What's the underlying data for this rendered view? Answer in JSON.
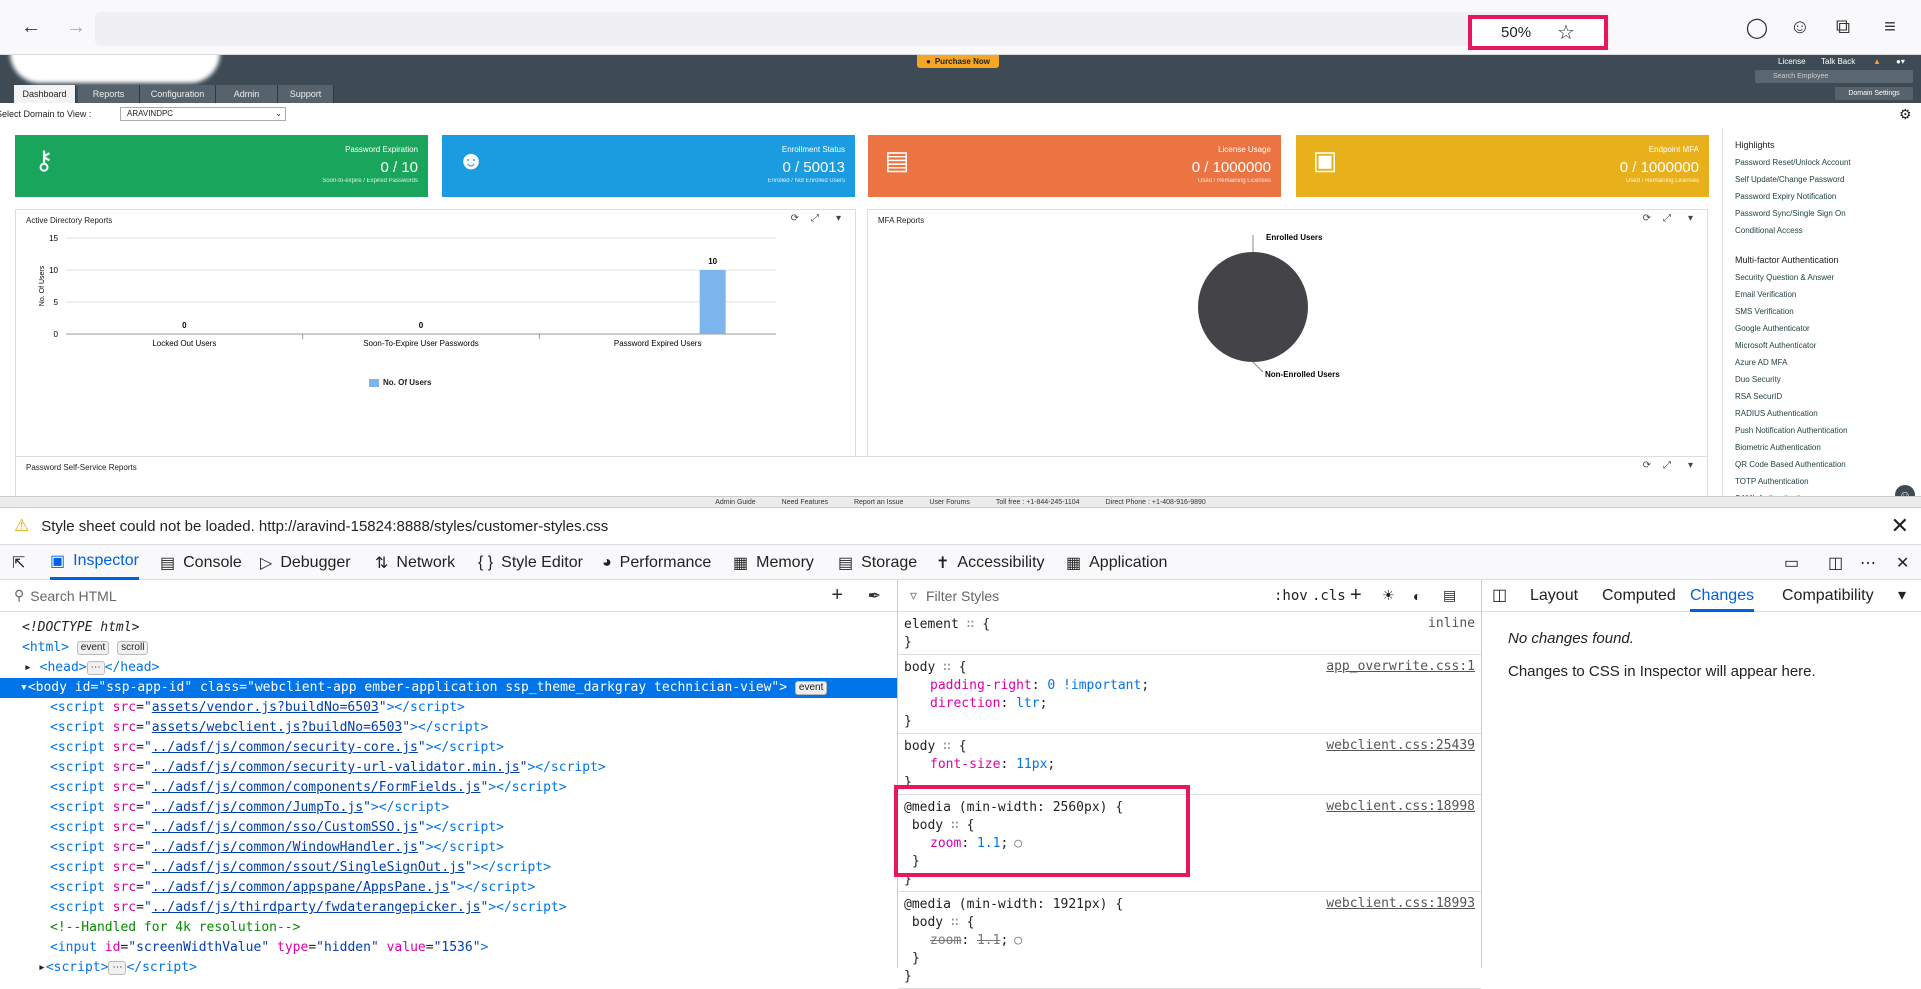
{
  "browser": {
    "zoom": "50%"
  },
  "app": {
    "purchase": "Purchase Now",
    "header_links": [
      "License",
      "Talk Back"
    ],
    "search_placeholder": "Search Employee",
    "domain_settings": "Domain Settings",
    "tabs": [
      "Dashboard",
      "Reports",
      "Configuration",
      "Admin",
      "Support"
    ],
    "domain_label": "Select Domain to View :",
    "domain_value": "ARAVINDPC",
    "cards": [
      {
        "title": "Password Expiration",
        "value": "0 / 10",
        "sub": "Soon-to-expire / Expired Passwords",
        "color": "#1aa55c"
      },
      {
        "title": "Enrollment Status",
        "value": "0 / 50013",
        "sub": "Enrolled / Not Enrolled Users",
        "color": "#1b9be0"
      },
      {
        "title": "License Usage",
        "value": "0 / 1000000",
        "sub": "Used / Remaining Licenses",
        "color": "#ec7442"
      },
      {
        "title": "Endpoint MFA",
        "value": "0 / 1000000",
        "sub": "Used / Remaining Licenses",
        "color": "#e8b01a"
      }
    ],
    "ad_panel_title": "Active Directory Reports",
    "mfa_panel_title": "MFA Reports",
    "pss_panel_title": "Password Self-Service Reports",
    "pie_labels": [
      "Enrolled Users",
      "Non-Enrolled Users"
    ],
    "highlights_title": "Highlights",
    "highlights": [
      "Password Reset/Unlock Account",
      "Self Update/Change Password",
      "Password Expiry Notification",
      "Password Sync/Single Sign On",
      "Conditional Access"
    ],
    "mfa_title": "Multi-factor Authentication",
    "mfa_items": [
      "Security Question & Answer",
      "Email Verification",
      "SMS Verification",
      "Google Authenticator",
      "Microsoft Authenticator",
      "Azure AD MFA",
      "Duo Security",
      "RSA SecurID",
      "RADIUS Authentication",
      "Push Notification Authentication",
      "Biometric Authentication",
      "QR Code Based Authentication",
      "TOTP Authentication",
      "SAML Authentication"
    ],
    "footer": [
      "Admin Guide",
      "Need Features",
      "Report an Issue",
      "User Forums",
      "Toll free : +1-844-245-1104",
      "Direct Phone : +1-408-916-9890"
    ]
  },
  "chart_data": {
    "type": "bar",
    "categories": [
      "Locked Out Users",
      "Soon-To-Expire User Passwords",
      "Password Expired Users"
    ],
    "values": [
      0,
      0,
      10
    ],
    "ylabel": "No. Of Users",
    "ylim": [
      0,
      15
    ],
    "yticks": [
      "15",
      "10",
      "5",
      "0"
    ],
    "legend": "No. Of Users",
    "color": "#7cb5ec"
  },
  "notification": {
    "text": "Style sheet could not be loaded. http://aravind-15824:8888/styles/customer-styles.css"
  },
  "devtools": {
    "tabs": [
      "Inspector",
      "Console",
      "Debugger",
      "Network",
      "Style Editor",
      "Performance",
      "Memory",
      "Storage",
      "Accessibility",
      "Application"
    ],
    "search_html_placeholder": "Search HTML",
    "filter_styles_placeholder": "Filter Styles",
    "hov": ":hov",
    "cls": ".cls",
    "side_tabs": [
      "Layout",
      "Computed",
      "Changes",
      "Compatibility"
    ],
    "no_changes": "No changes found.",
    "changes_hint": "Changes to CSS in Inspector will appear here.",
    "markup": {
      "doctype": "<!DOCTYPE html>",
      "html_open": "html",
      "html_badges": [
        "event",
        "scroll"
      ],
      "head": "<head>",
      "head_close": "</head>",
      "body_id": "ssp-app-id",
      "body_class": "webclient-app ember-application ssp_theme_darkgray technician-view",
      "body_badge": "event",
      "scripts": [
        "assets/vendor.js?buildNo=6503",
        "assets/webclient.js?buildNo=6503",
        "../adsf/js/common/security-core.js",
        "../adsf/js/common/security-url-validator.min.js",
        "../adsf/js/common/components/FormFields.js",
        "../adsf/js/common/JumpTo.js",
        "../adsf/js/common/sso/CustomSSO.js",
        "../adsf/js/common/WindowHandler.js",
        "../adsf/js/common/ssout/SingleSignOut.js",
        "../adsf/js/common/appspane/AppsPane.js",
        "../adsf/js/thirdparty/fwdaterangepicker.js"
      ],
      "comment": "<!--Handled for 4k resolution-->",
      "input_id": "screenWidthValue",
      "input_type": "hidden",
      "input_value": "1536"
    },
    "rules": [
      {
        "selector": "element",
        "source": "inline",
        "decls": []
      },
      {
        "selector": "body",
        "source": "app_overwrite.css:1",
        "decls": [
          {
            "p": "padding-right",
            "v": "0 !important"
          },
          {
            "p": "direction",
            "v": "ltr"
          }
        ]
      },
      {
        "selector": "body",
        "source": "webclient.css:25439",
        "decls": [
          {
            "p": "font-size",
            "v": "11px"
          }
        ]
      },
      {
        "media": "@media (min-width: 2560px) {",
        "selector": "body",
        "source": "webclient.css:18998",
        "decls": [
          {
            "p": "zoom",
            "v": "1.1"
          }
        ]
      },
      {
        "media": "@media (min-width: 1921px) {",
        "selector": "body",
        "source": "webclient.css:18993",
        "decls": [
          {
            "p": "zoom",
            "v": "1.1",
            "strike": true
          }
        ]
      }
    ]
  }
}
